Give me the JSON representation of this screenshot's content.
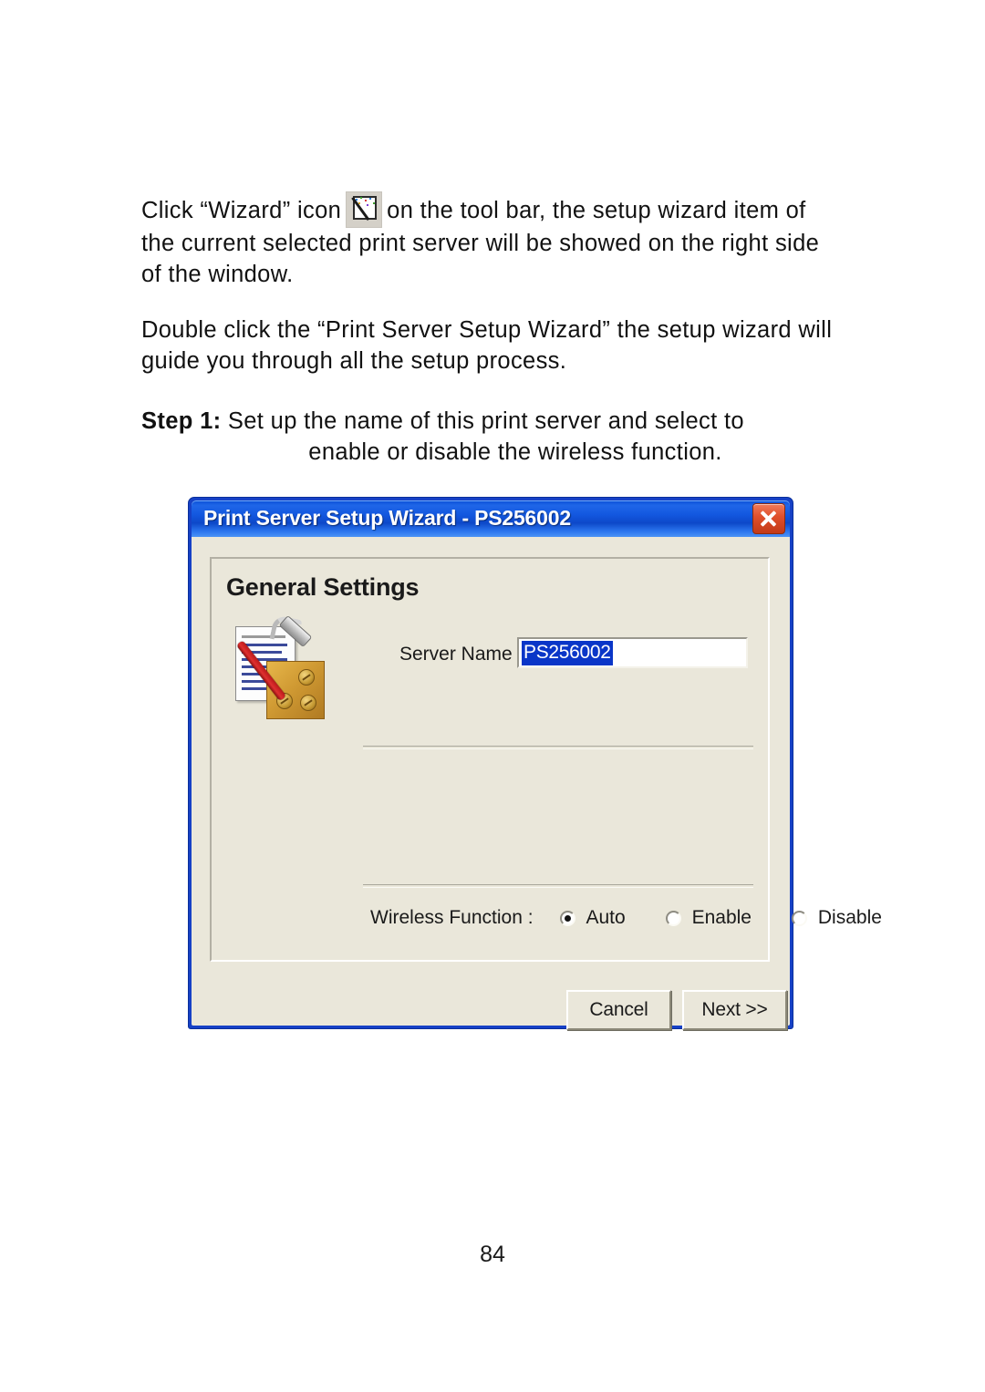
{
  "document": {
    "paragraphs": [
      {
        "id": "para-1",
        "before_icon": "Click “Wizard” icon",
        "icon": "wizard-wand-icon",
        "after_icon": "on the tool bar, the setup wizard item of the current selected print server will be showed on the right side of the window."
      },
      {
        "id": "para-2",
        "text": "Double click the “Print Server Setup Wizard” the setup wizard will guide you through all the setup process."
      },
      {
        "id": "para-3",
        "step_label": "Step 1:",
        "line1": " Set up the name of this print server and select to",
        "line2": "enable or disable the wireless function."
      }
    ],
    "page_number": "84"
  },
  "dialog": {
    "title": "Print Server Setup Wizard - PS256002",
    "close_icon": "close-x-icon",
    "group_title": "General Settings",
    "settings_icon": "document-hammer-tools-icon",
    "server_name": {
      "label": "Server Name :",
      "value": "PS256002",
      "placeholder": "PS256002",
      "selected": true
    },
    "wireless": {
      "label": "Wireless Function :",
      "options": [
        {
          "label": "Auto",
          "checked": true
        },
        {
          "label": "Enable",
          "checked": false
        },
        {
          "label": "Disable",
          "checked": false
        }
      ]
    },
    "buttons": {
      "cancel": "Cancel",
      "next": "Next >>"
    },
    "colors": {
      "titlebar_blue": "#1358e0",
      "frame_blue": "#1641c6",
      "close_red": "#e0502c",
      "face": "#eae7da",
      "selection_blue": "#0a36c8"
    }
  }
}
